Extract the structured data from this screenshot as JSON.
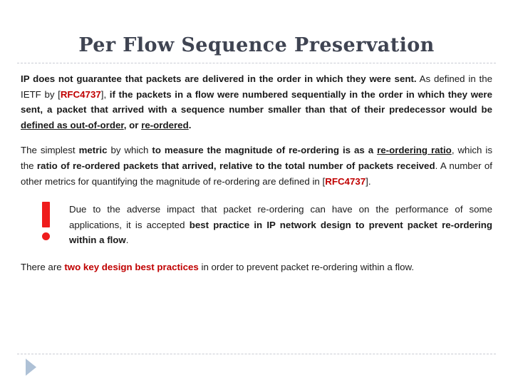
{
  "slide": {
    "title": "Per Flow Sequence Preservation",
    "accent_red": "#c00000",
    "alert_red": "#ef1c1c",
    "title_color": "#3f4452",
    "rule_color": "#c9ccd4",
    "play_color": "#aec1d6"
  },
  "paragraph1": {
    "seg1": "IP does not guarantee that packets are delivered in the order in which they were sent.",
    "seg2": " As defined in the IETF by [",
    "rfc_a": "RFC4737",
    "seg3": "], ",
    "seg4": "if the packets in a flow were numbered sequentially in the order in which they were sent, a packet that arrived with a sequence number smaller than that of their predecessor would be ",
    "seg5": "defined as out-of-order",
    "seg6": ", or ",
    "seg7": "re-ordered",
    "seg8": "."
  },
  "paragraph2": {
    "seg1": "The simplest ",
    "seg2": "metric",
    "seg3": " by which ",
    "seg4": "to measure the magnitude of re-ordering is as a ",
    "seg5": "re-ordering ratio",
    "seg6": ", which is the ",
    "seg7": "ratio of re-ordered packets that arrived, relative to the total number of packets received",
    "seg8": ". A number of other metrics for quantifying the magnitude of re-ordering are defined in [",
    "rfc_b": "RFC4737",
    "seg9": "]."
  },
  "callout": {
    "icon": "exclamation-mark-icon",
    "seg1": "Due to the adverse impact that packet re-ordering can have on the performance of some applications, it is accepted ",
    "seg2": "best practice in IP network design to prevent packet re-ordering within a flow",
    "seg3": "."
  },
  "paragraph3": {
    "seg1": "There are ",
    "seg2": "two key design best practices",
    "seg3": " in order to prevent packet re-ordering within a flow."
  },
  "footer": {
    "play_icon": "play-triangle-icon"
  }
}
